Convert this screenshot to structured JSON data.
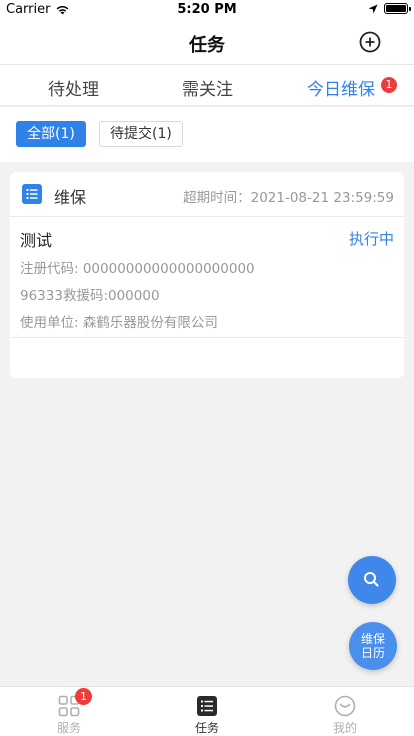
{
  "status_bar": {
    "carrier": "Carrier",
    "time": "5:20 PM"
  },
  "nav": {
    "title": "任务",
    "add_icon": "plus-circle-icon"
  },
  "top_tabs": [
    {
      "label": "待处理",
      "active": false
    },
    {
      "label": "需关注",
      "active": false
    },
    {
      "label": "今日维保",
      "active": true,
      "badge": "1"
    }
  ],
  "filters": [
    {
      "label": "全部(1)",
      "active": true
    },
    {
      "label": "待提交(1)",
      "active": false
    }
  ],
  "task_card": {
    "type": "维保",
    "deadline": "超期时间：2021-08-21 23:59:59",
    "name": "测试",
    "status": "执行中",
    "reg_code": "注册代码: 00000000000000000000",
    "rescue_code": "96333救援码:000000",
    "unit": "使用单位: 森鹤乐器股份有限公司"
  },
  "fab": {
    "search_icon": "search-icon",
    "calendar_line1": "维保",
    "calendar_line2": "日历"
  },
  "tab_bar": [
    {
      "label": "服务",
      "icon": "grid-icon",
      "badge": "1",
      "active": false
    },
    {
      "label": "任务",
      "icon": "task-list-icon",
      "active": true
    },
    {
      "label": "我的",
      "icon": "smile-icon",
      "active": false
    }
  ],
  "colors": {
    "accent": "#2f83e8",
    "badge": "#ee3b3b"
  }
}
